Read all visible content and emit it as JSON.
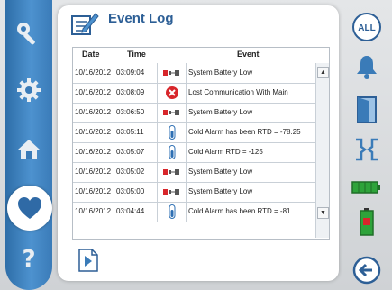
{
  "window": {
    "title": "Event Log"
  },
  "table": {
    "headers": {
      "date": "Date",
      "time": "Time",
      "event": "Event"
    },
    "rows": [
      {
        "date": "10/16/2012",
        "time": "03:09:04",
        "icon": "battery-icon",
        "event": "System Battery Low"
      },
      {
        "date": "10/16/2012",
        "time": "03:08:09",
        "icon": "error-x-icon",
        "event": "Lost Communication With Main"
      },
      {
        "date": "10/16/2012",
        "time": "03:06:50",
        "icon": "battery-icon",
        "event": "System Battery Low"
      },
      {
        "date": "10/16/2012",
        "time": "03:05:11",
        "icon": "thermometer-icon",
        "event": "Cold Alarm has been RTD = -78.25"
      },
      {
        "date": "10/16/2012",
        "time": "03:05:07",
        "icon": "thermometer-icon",
        "event": "Cold Alarm RTD = -125"
      },
      {
        "date": "10/16/2012",
        "time": "03:05:02",
        "icon": "battery-icon",
        "event": "System Battery Low"
      },
      {
        "date": "10/16/2012",
        "time": "03:05:00",
        "icon": "battery-icon",
        "event": "System Battery Low"
      },
      {
        "date": "10/16/2012",
        "time": "03:04:44",
        "icon": "thermometer-icon",
        "event": "Cold Alarm has been RTD = -81"
      }
    ]
  },
  "right_rail": {
    "all_label": "ALL"
  },
  "left_rail": {
    "help_label": "?"
  },
  "icons": {
    "left": [
      "wrench-icon",
      "gear-icon",
      "home-icon",
      "heart-icon",
      "help-icon"
    ],
    "right": [
      "all-icon",
      "bell-icon",
      "door-icon",
      "brackets-icon",
      "battery-bar-icon",
      "battery-vertical-icon",
      "back-arrow-icon"
    ]
  },
  "colors": {
    "rail_blue": "#3a7bb8",
    "title_blue": "#2d5f96",
    "error_red": "#d8262b",
    "battery_green": "#2ea33a"
  }
}
